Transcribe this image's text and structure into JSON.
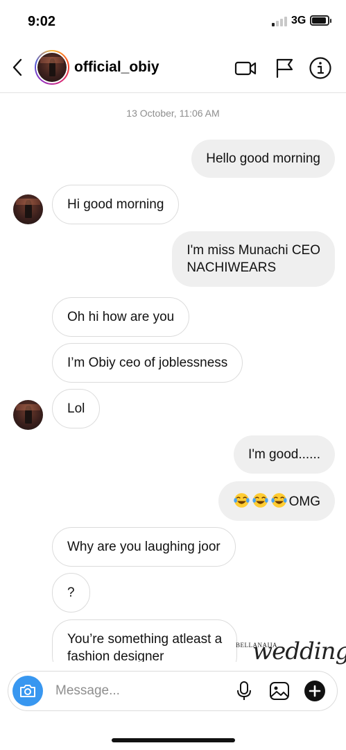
{
  "status_bar": {
    "time": "9:02",
    "network": "3G",
    "signal_bars_active": 1,
    "battery_level": 0.8
  },
  "header": {
    "username": "official_obiy",
    "icons": [
      "back-icon",
      "video-call-icon",
      "flag-icon",
      "info-icon"
    ]
  },
  "thread": {
    "timestamp": "13 October, 11:06 AM",
    "messages": [
      {
        "from": "me",
        "text": "Hello good morning"
      },
      {
        "from": "them",
        "text": "Hi good morning"
      },
      {
        "from": "me",
        "line1": "I'm miss Munachi CEO",
        "line2": "NACHIWEARS"
      },
      {
        "from": "them",
        "text": "Oh hi how are you"
      },
      {
        "from": "them",
        "text": "I’m Obiy ceo of joblessness"
      },
      {
        "from": "them",
        "text": "Lol"
      },
      {
        "from": "me",
        "text": "I'm good......"
      },
      {
        "from": "me",
        "emoji": [
          "face-with-tears-of-joy",
          "face-with-tears-of-joy",
          "face-with-tears-of-joy"
        ],
        "text": "OMG"
      },
      {
        "from": "them",
        "text": "Why are you laughing joor"
      },
      {
        "from": "them",
        "text": "?"
      },
      {
        "from": "them",
        "line1": "You’re something atleast a",
        "line2": "fashion designer"
      }
    ]
  },
  "watermark": {
    "brand": "BELLANAIJA",
    "script": "weddings"
  },
  "composer": {
    "placeholder": "Message...",
    "icons": [
      "camera-icon",
      "microphone-icon",
      "gallery-icon",
      "plus-icon"
    ]
  },
  "colors": {
    "accent": "#3897f0",
    "outgoing_bubble": "#efefef",
    "incoming_border": "#dbdbdb",
    "muted_text": "#8e8e8e"
  }
}
